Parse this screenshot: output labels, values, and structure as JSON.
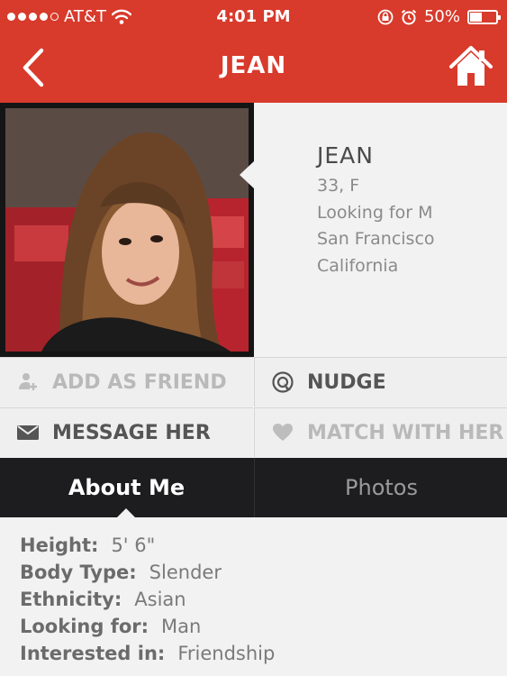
{
  "status_bar": {
    "carrier": "AT&T",
    "time": "4:01 PM",
    "battery_percent": "50%",
    "battery_level": 0.5
  },
  "nav": {
    "title": "JEAN",
    "back_icon": "chevron-left-icon",
    "home_icon": "home-icon"
  },
  "profile": {
    "name": "JEAN",
    "age_sex": "33, F",
    "looking_for": "Looking for M",
    "city": "San Francisco",
    "state": "California"
  },
  "actions": [
    {
      "label": "ADD AS FRIEND",
      "icon": "add-friend-icon",
      "enabled": false
    },
    {
      "label": "NUDGE",
      "icon": "nudge-icon",
      "enabled": true
    },
    {
      "label": "MESSAGE HER",
      "icon": "envelope-icon",
      "enabled": true
    },
    {
      "label": "MATCH WITH HER",
      "icon": "heart-icon",
      "enabled": false
    }
  ],
  "tabs": [
    {
      "label": "About Me",
      "active": true
    },
    {
      "label": "Photos",
      "active": false
    }
  ],
  "about": [
    {
      "label": "Height:",
      "value": "5' 6\""
    },
    {
      "label": "Body Type:",
      "value": "Slender"
    },
    {
      "label": "Ethnicity:",
      "value": "Asian"
    },
    {
      "label": "Looking for:",
      "value": "Man"
    },
    {
      "label": "Interested in:",
      "value": "Friendship"
    }
  ],
  "colors": {
    "accent": "#d83a2b",
    "tab_bar": "#1d1d1f",
    "background": "#f2f2f2"
  }
}
